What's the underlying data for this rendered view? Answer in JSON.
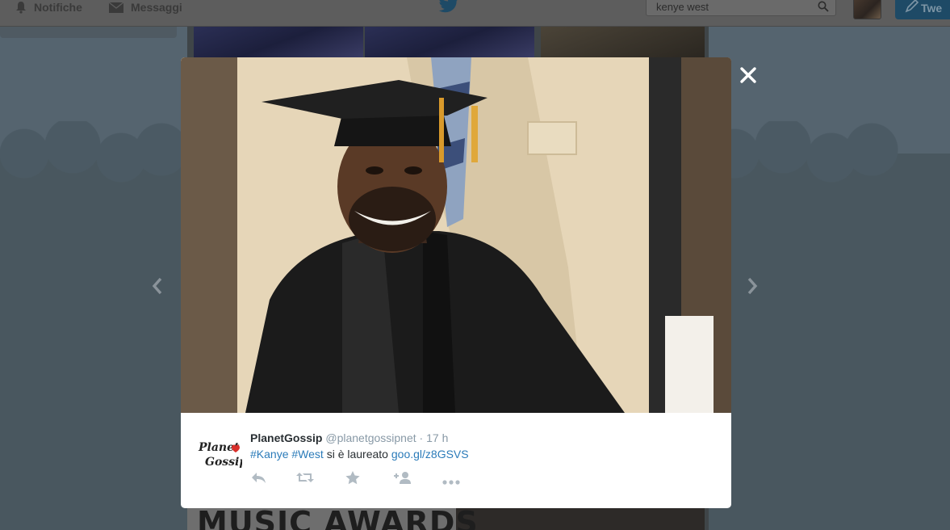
{
  "topbar": {
    "notifications_label": "Notifiche",
    "messages_label": "Messaggi",
    "search_value": "kenye west",
    "tweet_button_label": "Twe"
  },
  "background": {
    "banner_text": "MUSIC AWARDS"
  },
  "tweet": {
    "author_name": "PlanetGossip",
    "author_handle": "@planetgossipnet",
    "separator": " · ",
    "time": "17 h",
    "hashtag1": "#Kanye",
    "hashtag2": "#West",
    "text_middle": "si è laureato",
    "link": "goo.gl/z8GSVS",
    "avatar_logo_line1": "Planet",
    "avatar_logo_line2": "Gossip"
  },
  "icons": {
    "close": "close-icon",
    "prev": "chevron-left-icon",
    "next": "chevron-right-icon",
    "reply": "reply-icon",
    "retweet": "retweet-icon",
    "favorite": "star-icon",
    "follow": "follow-icon",
    "more": "more-icon"
  },
  "colors": {
    "link": "#2b7bb9",
    "muted": "#8899a6",
    "action_icon": "#b1bbc3"
  }
}
